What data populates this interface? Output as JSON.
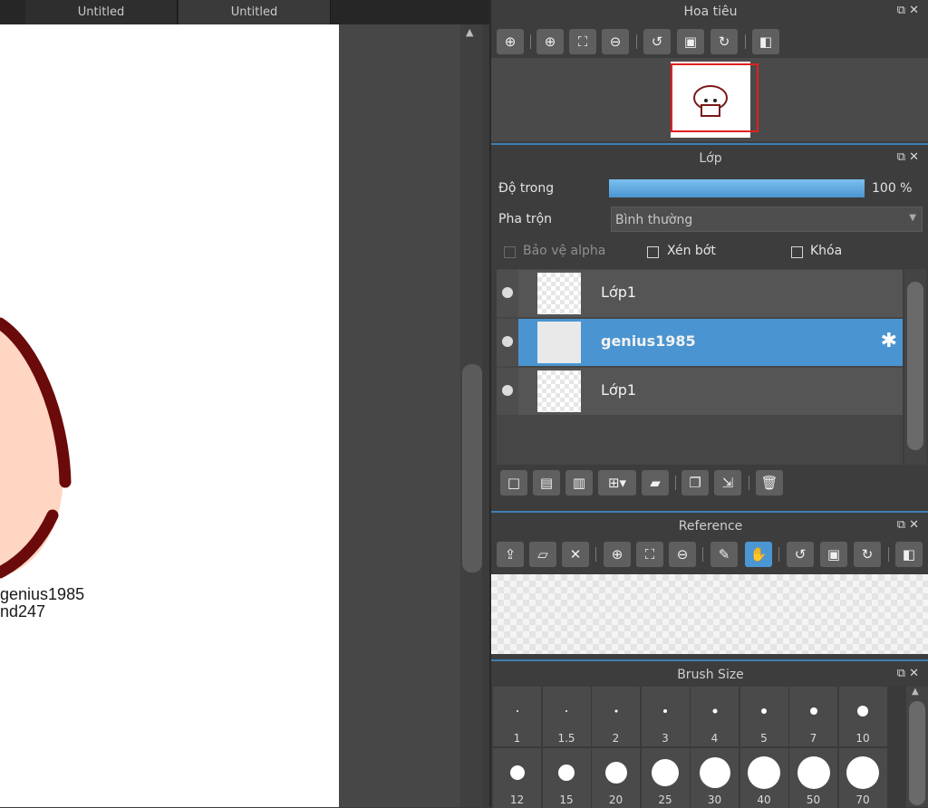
{
  "tabs": [
    "Untitled",
    "Untitled"
  ],
  "canvas": {
    "text_lines": [
      "genius1985",
      "nd247"
    ],
    "colors": {
      "outline": "#6b0a0a",
      "skin": "#ffd6c2"
    }
  },
  "navigator": {
    "title": "Hoa tiêu",
    "tools": [
      "zoom-fit-icon",
      "zoom-in-icon",
      "fit-screen-icon",
      "zoom-out-icon",
      "rotate-left-icon",
      "reset-view-icon",
      "rotate-right-icon",
      "flip-icon"
    ]
  },
  "layers_panel": {
    "title": "Lớp",
    "opacity_label": "Độ trong",
    "opacity_value": "100 %",
    "opacity_fraction": 1.0,
    "blend_label": "Pha trộn",
    "blend_value": "Bình thường",
    "protect_alpha_label": "Bảo vệ alpha",
    "clip_label": "Xén bớt",
    "lock_label": "Khóa",
    "layers": [
      {
        "name": "Lớp1",
        "selected": false
      },
      {
        "name": "genius1985",
        "selected": true
      },
      {
        "name": "Lớp1",
        "selected": false
      }
    ],
    "toolbar": [
      "new-layer-icon",
      "new-layer-8bit-icon",
      "new-layer-1bit-icon",
      "add-layer-menu-icon",
      "new-folder-icon",
      "duplicate-layer-icon",
      "merge-down-icon",
      "delete-layer-icon"
    ]
  },
  "reference_panel": {
    "title": "Reference",
    "tools": [
      "open-upload-icon",
      "open-folder-icon",
      "close-icon",
      "zoom-in-icon",
      "fit-screen-icon",
      "zoom-out-icon",
      "eyedropper-icon",
      "hand-icon",
      "rotate-left-icon",
      "reset-view-icon",
      "rotate-right-icon",
      "flip-icon"
    ]
  },
  "brush_size": {
    "title": "Brush Size",
    "sizes": [
      "1",
      "1.5",
      "2",
      "3",
      "4",
      "5",
      "7",
      "10",
      "12",
      "15",
      "20",
      "25",
      "30",
      "40",
      "50",
      "70"
    ]
  },
  "colors": {
    "accent": "#4a95d1",
    "panel_bg": "#3d3d3d",
    "selection_red": "#e02020"
  }
}
